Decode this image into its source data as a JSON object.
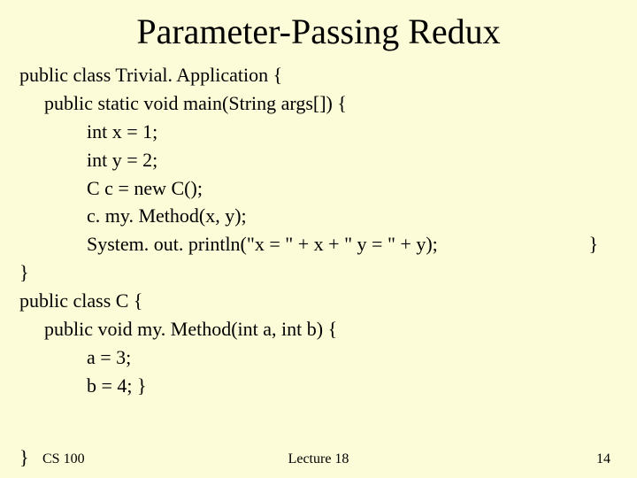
{
  "title": "Parameter-Passing Redux",
  "code": {
    "l1": "public class Trivial. Application {",
    "l2": "public static void main(String args[]) {",
    "l3": "int x = 1;",
    "l4": "int y = 2;",
    "l5": "C c = new C();",
    "l6": "c. my. Method(x, y);",
    "l7": "System. out. println(\"x = \" + x + \" y = \" + y);",
    "l7b": "}",
    "l8": "}",
    "l9": "public class C {",
    "l10": "public void my. Method(int a, int b) {",
    "l11": "a = 3;",
    "l12": "b = 4; }"
  },
  "footer": {
    "brace": "}",
    "left": "CS 100",
    "center": "Lecture 18",
    "right": "14"
  }
}
